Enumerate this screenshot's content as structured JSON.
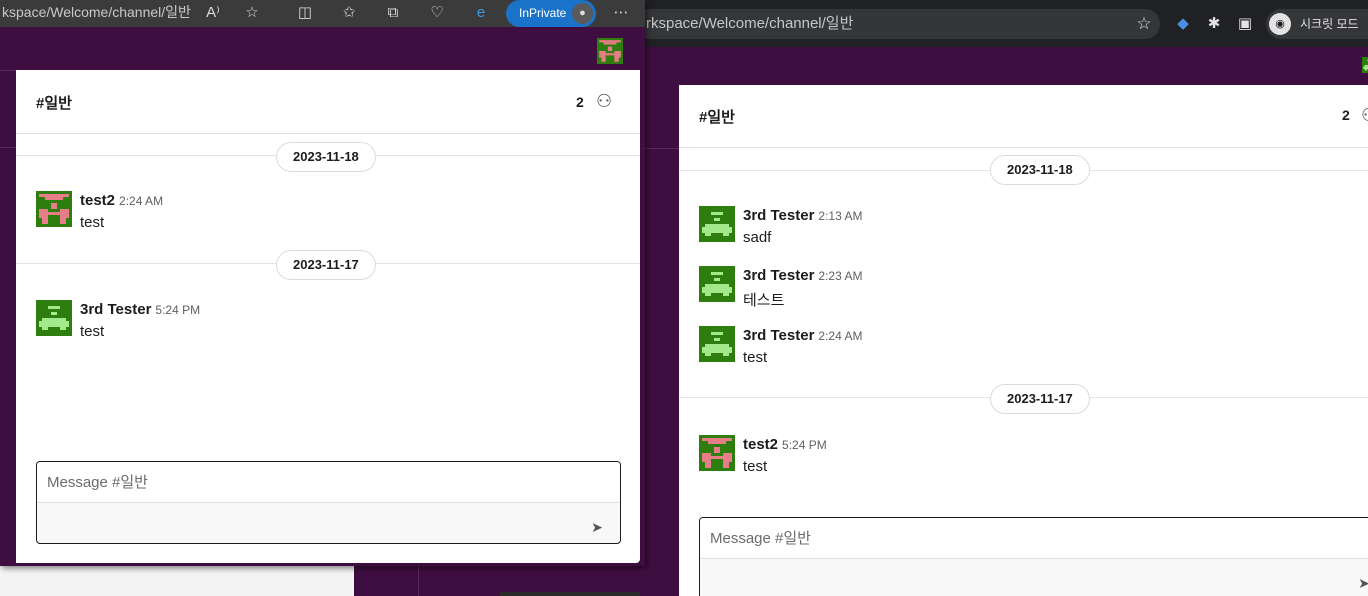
{
  "right_window": {
    "url": "rkspace/Welcome/channel/일반",
    "incognito_label": "시크릿 모드",
    "channel_title": "#일반",
    "member_count": "2",
    "messages_a": [
      {
        "author": "3rd Tester",
        "time": "2:13 AM",
        "text": "sadf"
      },
      {
        "author": "3rd Tester",
        "time": "2:23 AM",
        "text": "테스트"
      },
      {
        "author": "3rd Tester",
        "time": "2:24 AM",
        "text": "test"
      }
    ],
    "date_a": "2023-11-18",
    "date_b": "2023-11-17",
    "messages_b": [
      {
        "author": "test2",
        "time": "5:24 PM",
        "text": "test"
      }
    ],
    "composer_placeholder": "Message #일반"
  },
  "left_window": {
    "url": "kspace/Welcome/channel/일반",
    "inprivate_label": "InPrivate",
    "channel_title": "#일반",
    "member_count": "2",
    "date_a": "2023-11-18",
    "messages_a": [
      {
        "author": "test2",
        "time": "2:24 AM",
        "text": "test"
      }
    ],
    "date_b": "2023-11-17",
    "messages_b": [
      {
        "author": "3rd Tester",
        "time": "5:24 PM",
        "text": "test"
      }
    ],
    "composer_placeholder": "Message #일반"
  },
  "icons": {
    "read_aloud": "read-aloud-icon",
    "favorite": "star-icon",
    "split": "split-screen-icon",
    "favorites": "favorites-icon",
    "collections": "collections-icon",
    "health": "browser-essentials-icon",
    "ie_mode": "ie-mode-icon",
    "more": "more-icon",
    "extensions": "puzzle-icon",
    "sidepanel": "side-panel-icon",
    "add_user": "add-user-icon",
    "send": "send-icon"
  },
  "colors": {
    "workspace_purple": "#3f0e40",
    "inprivate_blue": "#1a73c9",
    "avatar_green": "#2e7d0f",
    "avatar_pink": "#e87d8a"
  }
}
